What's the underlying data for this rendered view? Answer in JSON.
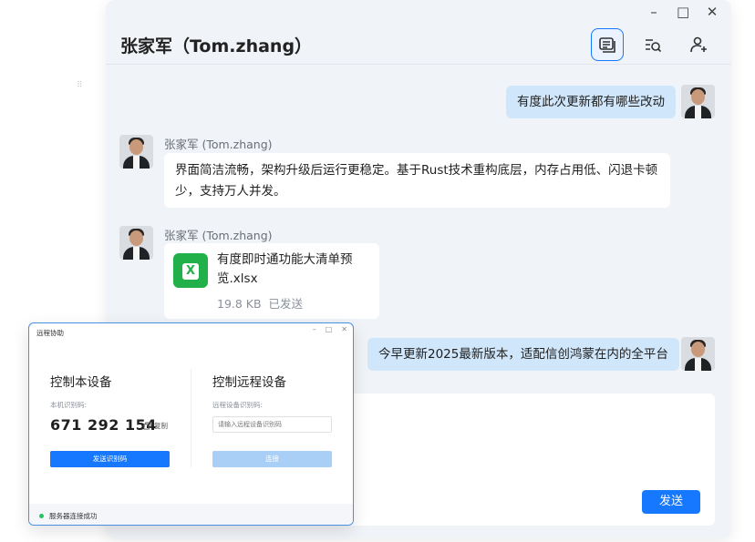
{
  "chat": {
    "title": "张家军（Tom.zhang）",
    "window_controls": [
      "–",
      "□",
      "✕"
    ],
    "messages": [
      {
        "side": "right",
        "text": "有度此次更新都有哪些改动"
      },
      {
        "side": "left",
        "sender": "张家军 (Tom.zhang)",
        "text": "界面简洁流畅，架构升级后运行更稳定。基于Rust技术重构底层，内存占用低、闪退卡顿少，支持万人并发。"
      },
      {
        "side": "left",
        "sender": "张家军 (Tom.zhang)",
        "type": "file",
        "file_name": "有度即时通功能大清单预览.xlsx",
        "file_size": "19.8 KB",
        "file_status": "已发送",
        "file_icon_letter": "X"
      },
      {
        "side": "right",
        "text": "今早更新2025最新版本，适配信创鸿蒙在内的全平台"
      }
    ],
    "send_label": "发送",
    "header_icons": [
      "chat-history-icon",
      "search-list-icon",
      "add-user-icon"
    ]
  },
  "remote": {
    "title": "远程协助",
    "window_controls": [
      "–",
      "□",
      "✕"
    ],
    "local": {
      "title": "控制本设备",
      "code_label": "本机识别码:",
      "code": "671 292 154",
      "copy_label": "复制",
      "send_code_label": "发送识别码"
    },
    "remote": {
      "title": "控制远程设备",
      "code_label": "远程设备识别码:",
      "placeholder": "请输入远程设备识别码",
      "connect_label": "连接"
    },
    "status": "服务器连接成功"
  },
  "colors": {
    "accent": "#1677ff",
    "bubble_right": "#cfe6fb",
    "status_ok": "#22c55e",
    "excel_green": "#22b04a"
  }
}
